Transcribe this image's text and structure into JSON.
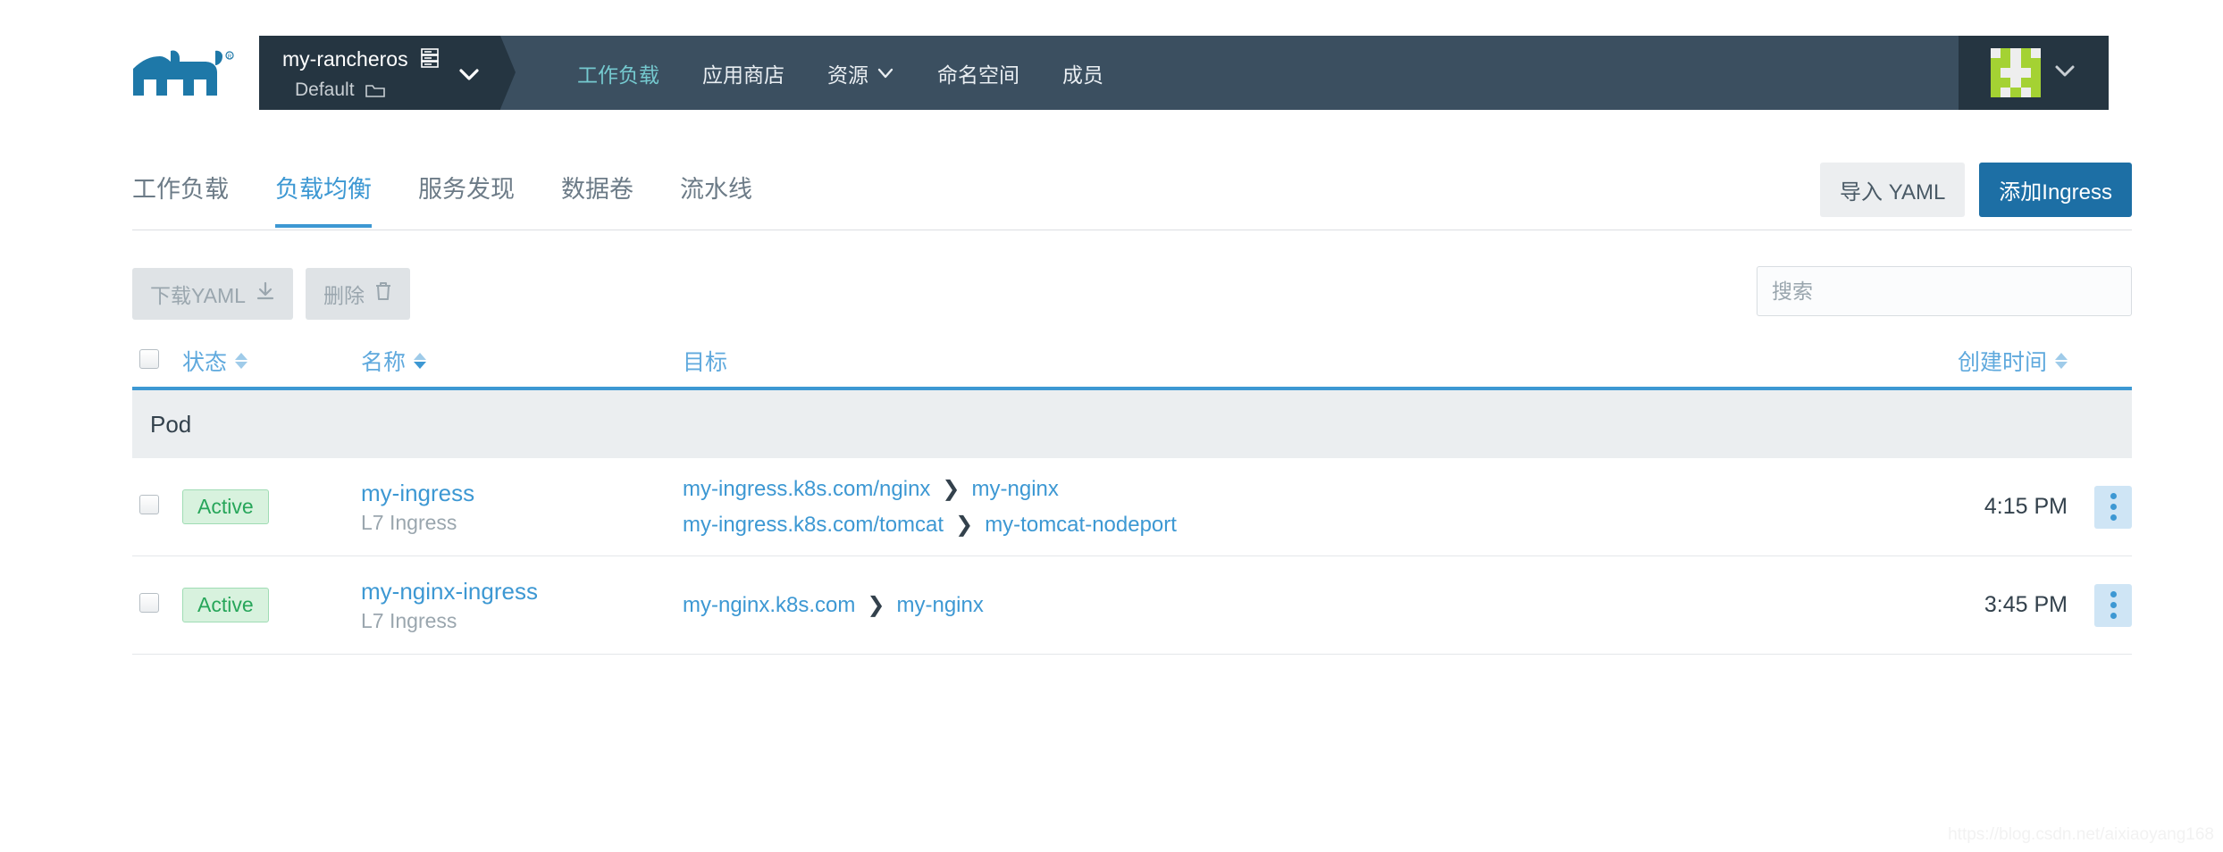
{
  "header": {
    "logo_icon": "rancher-cow-logo",
    "cluster": {
      "name": "my-rancheros",
      "name_icon": "server-icon",
      "project": "Default",
      "project_icon": "folder-icon",
      "caret_icon": "chevron-down-icon"
    },
    "nav_items": [
      {
        "label": "工作负载",
        "active": true,
        "caret": false
      },
      {
        "label": "应用商店",
        "active": false,
        "caret": false
      },
      {
        "label": "资源",
        "active": false,
        "caret": true
      },
      {
        "label": "命名空间",
        "active": false,
        "caret": false
      },
      {
        "label": "成员",
        "active": false,
        "caret": false
      }
    ],
    "user": {
      "avatar_icon": "user-identicon-avatar",
      "caret_icon": "chevron-down-icon"
    }
  },
  "tabs": [
    {
      "label": "工作负载",
      "active": false
    },
    {
      "label": "负载均衡",
      "active": true
    },
    {
      "label": "服务发现",
      "active": false
    },
    {
      "label": "数据卷",
      "active": false
    },
    {
      "label": "流水线",
      "active": false
    }
  ],
  "header_actions": {
    "import_yaml_label": "导入 YAML",
    "add_ingress_label": "添加Ingress"
  },
  "toolbar": {
    "download_yaml_label": "下载YAML",
    "download_icon": "download-icon",
    "delete_label": "删除",
    "delete_icon": "trash-icon",
    "search_placeholder": "搜索",
    "search_value": ""
  },
  "table": {
    "columns": {
      "state": "状态",
      "name": "名称",
      "target": "目标",
      "created": "创建时间"
    },
    "group_label": "Pod",
    "rows": [
      {
        "state": "Active",
        "name": "my-ingress",
        "type": "L7 Ingress",
        "targets": [
          {
            "host": "my-ingress.k8s.com/nginx",
            "service": "my-nginx"
          },
          {
            "host": "my-ingress.k8s.com/tomcat",
            "service": "my-tomcat-nodeport"
          }
        ],
        "created": "4:15 PM",
        "menu_icon": "kebab-menu-icon"
      },
      {
        "state": "Active",
        "name": "my-nginx-ingress",
        "type": "L7 Ingress",
        "targets": [
          {
            "host": "my-nginx.k8s.com",
            "service": "my-nginx"
          }
        ],
        "created": "3:45 PM",
        "menu_icon": "kebab-menu-icon"
      }
    ]
  },
  "watermark": "https://blog.csdn.net/aixiaoyang168",
  "colors": {
    "navbar_dark": "#253541",
    "navbar_mid": "#3b4f60",
    "nav_active": "#75c9cf",
    "primary_blue": "#1d6fa5",
    "link_blue": "#3d98d3",
    "active_green": "#27a65a",
    "avatar_green": "#a4d233"
  }
}
